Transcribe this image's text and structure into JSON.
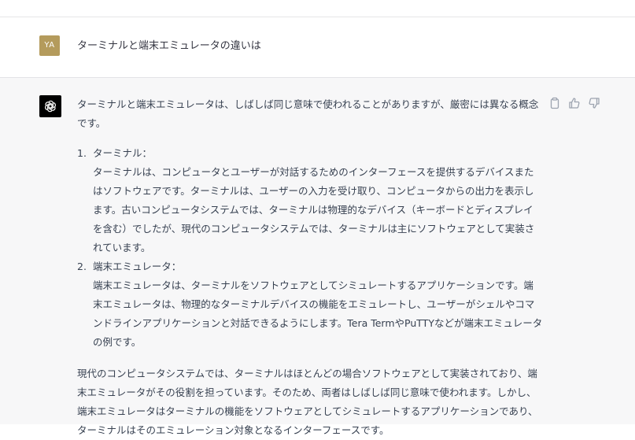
{
  "conversation": {
    "user_message": {
      "avatar_initials": "YA",
      "avatar_color": "#b49b5c",
      "text": "ターミナルと端末エミュレータの違いは"
    },
    "assistant_message": {
      "avatar_icon": "openai-logo-icon",
      "intro": "ターミナルと端末エミュレータは、しばしば同じ意味で使われることがありますが、厳密には異なる概念です。",
      "items": [
        {
          "number": "1.",
          "title": "ターミナル：",
          "body": "ターミナルは、コンピュータとユーザーが対話するためのインターフェースを提供するデバイスまたはソフトウェアです。ターミナルは、ユーザーの入力を受け取り、コンピュータからの出力を表示します。古いコンピュータシステムでは、ターミナルは物理的なデバイス（キーボードとディスプレイを含む）でしたが、現代のコンピュータシステムでは、ターミナルは主にソフトウェアとして実装されています。"
        },
        {
          "number": "2.",
          "title": "端末エミュレータ：",
          "body": "端末エミュレータは、ターミナルをソフトウェアとしてシミュレートするアプリケーションです。端末エミュレータは、物理的なターミナルデバイスの機能をエミュレートし、ユーザーがシェルやコマンドラインアプリケーションと対話できるようにします。Tera TermやPuTTYなどが端末エミュレータの例です。"
        }
      ],
      "closing": "現代のコンピュータシステムでは、ターミナルはほとんどの場合ソフトウェアとして実装されており、端末エミュレータがその役割を担っています。そのため、両者はしばしば同じ意味で使われます。しかし、端末エミュレータはターミナルの機能をソフトウェアとしてシミュレートするアプリケーションであり、ターミナルはそのエミュレーション対象となるインターフェースです。",
      "actions": [
        "copy-icon",
        "thumbs-up-icon",
        "thumbs-down-icon"
      ]
    }
  }
}
